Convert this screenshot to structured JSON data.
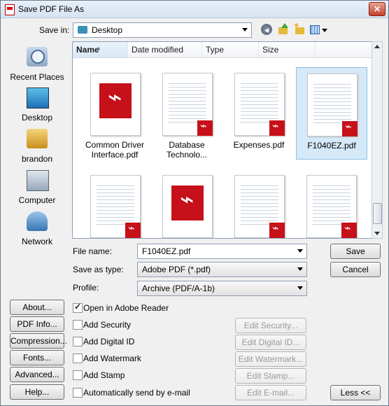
{
  "window": {
    "title": "Save PDF File As",
    "close": "✕"
  },
  "savein": {
    "label": "Save in:",
    "value": "Desktop"
  },
  "toolbar": {
    "back": "◂"
  },
  "places": [
    "Recent Places",
    "Desktop",
    "brandon",
    "Computer",
    "Network"
  ],
  "columns": [
    "Name",
    "Date modified",
    "Type",
    "Size"
  ],
  "files": [
    {
      "name_line1": "Common Driver",
      "name_line2": "Interface.pdf"
    },
    {
      "name_line1": "Database",
      "name_line2": "Technolo..."
    },
    {
      "name_line1": "Expenses.pdf",
      "name_line2": ""
    },
    {
      "name_line1": "F1040EZ.pdf",
      "name_line2": ""
    }
  ],
  "form": {
    "filename_label": "File name:",
    "filename_value": "F1040EZ.pdf",
    "type_label": "Save as type:",
    "type_value": "Adobe PDF (*.pdf)",
    "profile_label": "Profile:",
    "profile_value": "Archive (PDF/A-1b)"
  },
  "buttons": {
    "save": "Save",
    "cancel": "Cancel"
  },
  "side_buttons": [
    "About...",
    "PDF Info...",
    "Compression...",
    "Fonts...",
    "Advanced...",
    "Help..."
  ],
  "options": [
    {
      "label": "Open in Adobe Reader",
      "checked": true
    },
    {
      "label": "Add Security",
      "checked": false,
      "action": "Edit Security..."
    },
    {
      "label": "Add Digital ID",
      "checked": false,
      "action": "Edit Digital ID..."
    },
    {
      "label": "Add Watermark",
      "checked": false,
      "action": "Edit Watermark..."
    },
    {
      "label": "Add Stamp",
      "checked": false,
      "action": "Edit Stamp..."
    },
    {
      "label": "Automatically send by e-mail",
      "checked": false,
      "action": "Edit E-mail..."
    }
  ],
  "less_button": "Less <<"
}
